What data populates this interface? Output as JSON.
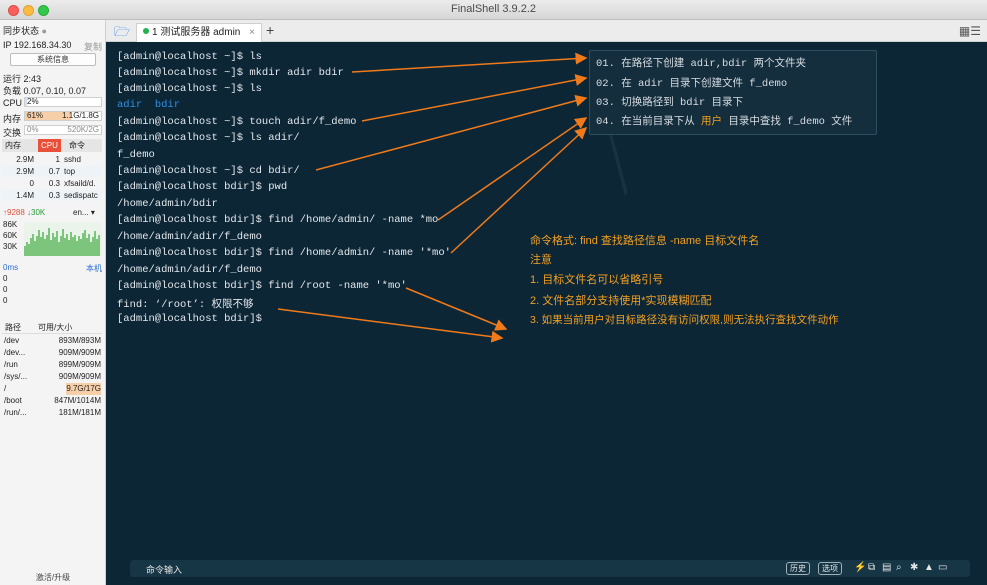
{
  "window": {
    "title": "FinalShell 3.9.2.2"
  },
  "sidebar": {
    "sync_status": "同步状态",
    "ip": "IP 192.168.34.30",
    "copy": "复制",
    "sysinfo_button": "系统信息",
    "uptime": "运行 2:43",
    "load": "负载 0.07, 0.10, 0.07",
    "cpu_label": "CPU",
    "cpu_value": "2%",
    "cpu_percent": 2,
    "mem_label": "内存",
    "mem_pct_text": "61%",
    "mem_value": "1.1G/1.8G",
    "mem_percent": 61,
    "swap_label": "交换",
    "swap_pct_text": "0%",
    "swap_value": "520K/2G",
    "proc_tabs": [
      "内存",
      "CPU",
      "命令"
    ],
    "processes": [
      {
        "mem": "2.9M",
        "cpu": "1",
        "cmd": "sshd"
      },
      {
        "mem": "2.9M",
        "cpu": "0.7",
        "cmd": "top"
      },
      {
        "mem": "0",
        "cpu": "0.3",
        "cmd": "xfsaild/d."
      },
      {
        "mem": "1.4M",
        "cpu": "0.3",
        "cmd": "sedispatc"
      }
    ],
    "net_up": "↑9288",
    "net_down": "↓30K",
    "net_iface": "en...",
    "net_scale": [
      "86K",
      "60K",
      "30K"
    ],
    "latency_label": "0ms",
    "latency_host": "本机",
    "latency_values": [
      "0",
      "0",
      "0"
    ],
    "fs_headers": [
      "路径",
      "可用/大小"
    ],
    "filesystems": [
      {
        "path": "/dev",
        "size": "893M/893M"
      },
      {
        "path": "/dev...",
        "size": "909M/909M"
      },
      {
        "path": "/run",
        "size": "899M/909M"
      },
      {
        "path": "/sys/...",
        "size": "909M/909M"
      },
      {
        "path": "/",
        "size": "9.7G/17G"
      },
      {
        "path": "/boot",
        "size": "847M/1014M"
      },
      {
        "path": "/run/...",
        "size": "181M/181M"
      }
    ],
    "footer": "激活/升级"
  },
  "tabs": {
    "active": "1 测试服务器 admin",
    "close": "×",
    "add": "+"
  },
  "terminal": {
    "lines": [
      "[admin@localhost ~]$ ls",
      "[admin@localhost ~]$ mkdir adir bdir",
      "[admin@localhost ~]$ ls",
      "adir  bdir",
      "[admin@localhost ~]$ touch adir/f_demo",
      "[admin@localhost ~]$ ls adir/",
      "f_demo",
      "[admin@localhost ~]$ cd bdir/",
      "[admin@localhost bdir]$ pwd",
      "/home/admin/bdir",
      "[admin@localhost bdir]$ find /home/admin/ -name *mo",
      "/home/admin/adir/f_demo",
      "[admin@localhost bdir]$ find /home/admin/ -name '*mo'",
      "/home/admin/adir/f_demo",
      "[admin@localhost bdir]$ find /root -name '*mo'",
      "find: ‘/root’: 权限不够",
      "[admin@localhost bdir]$"
    ],
    "dir_a": "adir",
    "dir_b": "bdir"
  },
  "notes": {
    "n1": "01. 在路径下创建 adir,bdir 两个文件夹",
    "n2": "02. 在 adir 目录下创建文件 f_demo",
    "n3": "03. 切换路径到 bdir 目录下",
    "n4_pre": "04. 在当前目录下从 ",
    "n4_hl": "用户",
    "n4_post": " 目录中查找 f_demo 文件"
  },
  "annotation": {
    "format": "命令格式: find 查找路径信息 -name 目标文件名",
    "attention": "注意",
    "p1": "1. 目标文件名可以省略引号",
    "p2": "2. 文件名部分支持使用*实现模糊匹配",
    "p3": "3. 如果当前用户对目标路径没有访问权限,则无法执行查找文件动作"
  },
  "cmdbar": {
    "label": "命令输入",
    "history": "历史",
    "options": "选项"
  },
  "colors": {
    "terminal_bg": "#0c2636",
    "annotation": "#f3a022",
    "arrow": "#f07a1a",
    "dir": "#2e8fe0"
  }
}
